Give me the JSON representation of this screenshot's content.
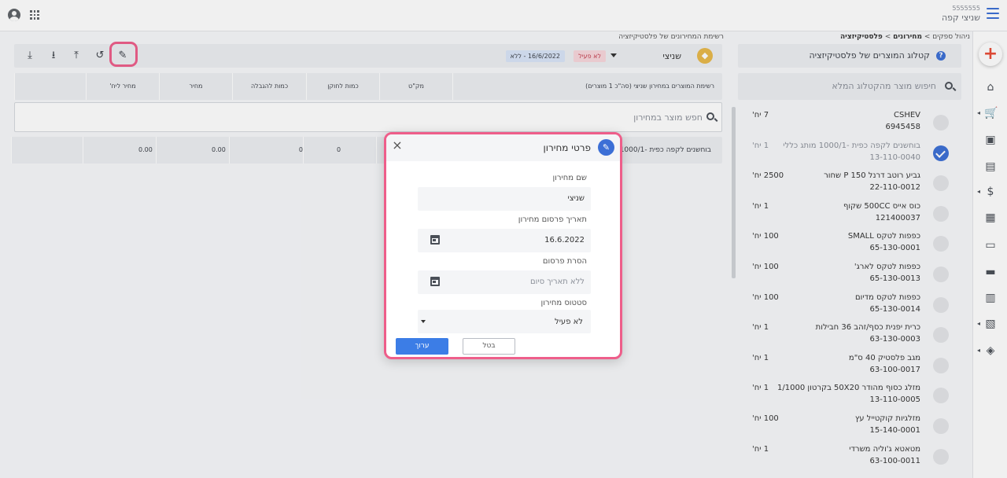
{
  "header": {
    "account_number": "5555555",
    "account_name": "שניצי קפה"
  },
  "breadcrumb": {
    "part1": "ניהול ספקים",
    "part2": "מחירונים",
    "part3": "פלסטיקיזציה",
    "separator": " > "
  },
  "main_breadcrumb": "רשימת המחירונים של פלסטיקיזציה",
  "catalog": {
    "title": "קטלוג המוצרים של פלסטיקיזציה",
    "search_placeholder": "חיפוש מוצר מהקטלוג המלא",
    "items": [
      {
        "name": "CSHEV",
        "code": "6945458",
        "qty": "7 יח'",
        "selected": false
      },
      {
        "name": "בוחשנים לקפה כפית -1000/1 מותג כללי",
        "code": "13-110-0040",
        "qty": "1 יח'",
        "selected": true
      },
      {
        "name": "גביע רוטב דרנל P 150 שחור",
        "code": "22-110-0012",
        "qty": "2500 יח'",
        "selected": false
      },
      {
        "name": "כוס אייס 500CC שקוף",
        "code": "121400037",
        "qty": "1 יח'",
        "selected": false
      },
      {
        "name": "כפפות לטקס SMALL",
        "code": "65-130-0001",
        "qty": "100 יח'",
        "selected": false
      },
      {
        "name": "כפפות לטקס לארג'",
        "code": "65-130-0013",
        "qty": "100 יח'",
        "selected": false
      },
      {
        "name": "כפפות לטקס מדיום",
        "code": "65-130-0014",
        "qty": "100 יח'",
        "selected": false
      },
      {
        "name": "כרית יפנית כסף/זהב 36 חבילות",
        "code": "63-130-0003",
        "qty": "1 יח'",
        "selected": false
      },
      {
        "name": "מגב פלסטיק 40 ס\"מ",
        "code": "63-100-0017",
        "qty": "1 יח'",
        "selected": false
      },
      {
        "name": "מזלג כסוף מהודר 50X20 בקרטון 1/1000",
        "code": "13-110-0005",
        "qty": "1 יח'",
        "selected": false
      },
      {
        "name": "מזלגיות קוקטייל עץ",
        "code": "15-140-0001",
        "qty": "100 יח'",
        "selected": false
      },
      {
        "name": "מטאטא ג'וליה משרדי",
        "code": "63-100-0011",
        "qty": "1 יח'",
        "selected": false
      }
    ]
  },
  "toolbar": {
    "pricelist_name": "שניצי",
    "status_badge": "לא פעיל",
    "date_badge": "16/6/2022 - ללא",
    "icons": [
      "edit-icon",
      "history-icon",
      "upload-icon",
      "download-icon",
      "import-icon"
    ]
  },
  "table": {
    "columns": [
      "רשימת המוצרים במחירון שניצי (סה\"כ 1 מוצרים)",
      "מק\"ט",
      "כמות לחוקן",
      "כמות להגבלה",
      "מחיר",
      "מחיר ליח'"
    ],
    "rows": [
      {
        "product": "בוחשנים לקפה כפית -1000/1 מו",
        "sku": "",
        "qty_min": "0",
        "qty_limit": "0",
        "price": "0.00",
        "unit_price": "0.00"
      }
    ],
    "search_placeholder": "חפש מוצר במחירון"
  },
  "modal": {
    "title": "פרטי מחירון",
    "name_label": "שם מחירון",
    "name_value": "שניצי",
    "publish_label": "תאריך פרסום מחירון",
    "publish_value": "16.6.2022",
    "unpublish_label": "הסרת פרסום",
    "unpublish_placeholder": "ללא תאריך סיום",
    "status_label": "סטטוס מחירון",
    "status_value": "לא פעיל",
    "save_label": "ערוך",
    "cancel_label": "בטל"
  },
  "colors": {
    "accent": "#3c6fd6",
    "highlight": "#ee5e8a",
    "inactive_badge": "#f8d7dc"
  }
}
